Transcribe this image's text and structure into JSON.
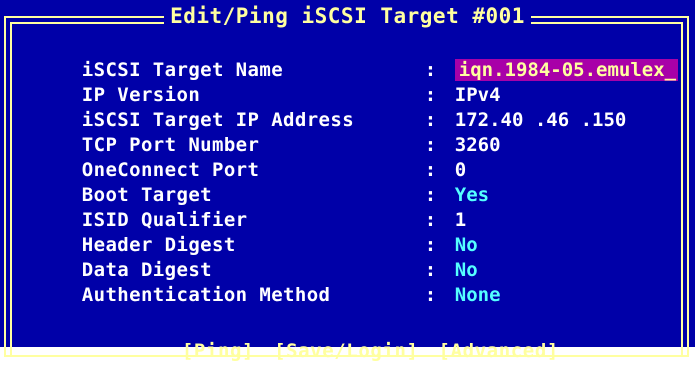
{
  "window": {
    "title": "Edit/Ping iSCSI Target #001"
  },
  "colors": {
    "background": "#0000a8",
    "frame": "#ffffa0",
    "label": "#ffffff",
    "value_highlight": "#55ffff",
    "selected_bg": "#a800a8"
  },
  "fields": [
    {
      "label": "iSCSI Target Name",
      "separator": ":",
      "value": "iqn.1984-05.emulex",
      "cursor": "_"
    },
    {
      "label": "IP Version",
      "separator": ":",
      "value": "IPv4"
    },
    {
      "label": "iSCSI Target IP Address",
      "separator": ":",
      "value": "172.40 .46 .150"
    },
    {
      "label": "TCP Port Number",
      "separator": ":",
      "value": "3260"
    },
    {
      "label": "OneConnect Port",
      "separator": ":",
      "value": "0"
    },
    {
      "label": "Boot Target",
      "separator": ":",
      "value": "Yes"
    },
    {
      "label": "ISID Qualifier",
      "separator": ":",
      "value": "1"
    },
    {
      "label": "Header Digest",
      "separator": ":",
      "value": "No"
    },
    {
      "label": "Data Digest",
      "separator": ":",
      "value": "No"
    },
    {
      "label": "Authentication Method",
      "separator": ":",
      "value": "None"
    }
  ],
  "buttons": {
    "ping": "[Ping]",
    "save_login": "[Save/Login]",
    "advanced": "[Advanced]"
  }
}
